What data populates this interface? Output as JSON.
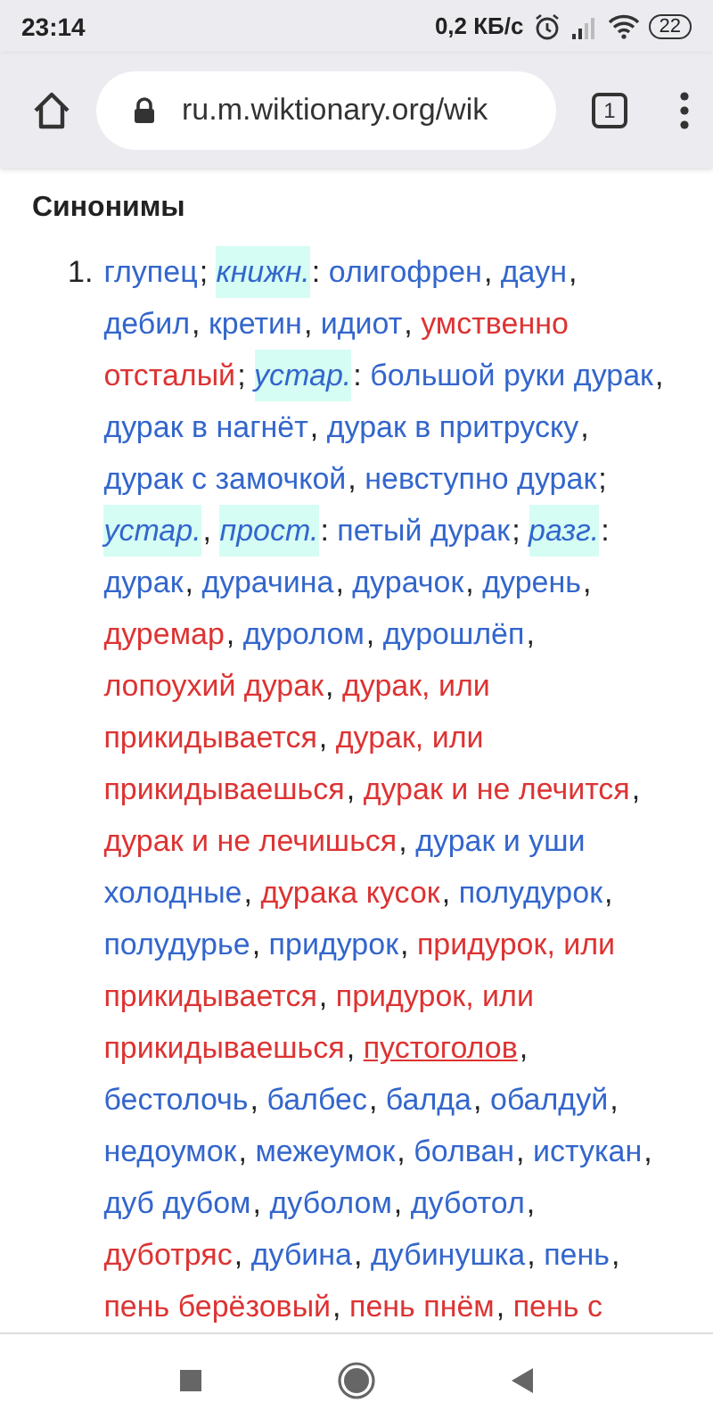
{
  "status_bar": {
    "time": "23:14",
    "speed": "0,2 КБ/с",
    "battery": "22"
  },
  "browser_bar": {
    "url": "ru.m.wiktionary.org/wik",
    "tab_count": "1"
  },
  "section": {
    "heading": "Синонимы",
    "number": "1.",
    "lines": [
      [
        {
          "kind": "link",
          "text": "глупец",
          "punct": "; "
        },
        {
          "kind": "label",
          "text": "книжн.",
          "punct": ": "
        },
        {
          "kind": "link",
          "text": "олигофрен",
          "punct": ", "
        },
        {
          "kind": "link",
          "text": "даун",
          "punct": ","
        }
      ],
      [
        {
          "kind": "link",
          "text": "дебил",
          "punct": ", "
        },
        {
          "kind": "link",
          "text": "кретин",
          "punct": ", "
        },
        {
          "kind": "link",
          "text": "идиот",
          "punct": ", "
        },
        {
          "kind": "redlink",
          "text": "умственно"
        }
      ],
      [
        {
          "kind": "redlink",
          "text": "отсталый",
          "punct": "; "
        },
        {
          "kind": "label",
          "text": "устар.",
          "punct": ": "
        },
        {
          "kind": "link",
          "text": "большой руки дурак",
          "punct": ","
        }
      ],
      [
        {
          "kind": "link",
          "text": "дурак в нагнёт",
          "punct": ", "
        },
        {
          "kind": "link",
          "text": "дурак в притруску",
          "punct": ","
        }
      ],
      [
        {
          "kind": "link",
          "text": "дурак с замочкой",
          "punct": ", "
        },
        {
          "kind": "link",
          "text": "невступно дурак",
          "punct": ";"
        }
      ],
      [
        {
          "kind": "label",
          "text": "устар.",
          "punct": ", "
        },
        {
          "kind": "label",
          "text": "прост.",
          "punct": ": "
        },
        {
          "kind": "link",
          "text": "петый дурак",
          "punct": "; "
        },
        {
          "kind": "label",
          "text": "разг.",
          "punct": ":"
        }
      ],
      [
        {
          "kind": "link",
          "text": "дурак",
          "punct": ", "
        },
        {
          "kind": "link",
          "text": "дурачина",
          "punct": ", "
        },
        {
          "kind": "link",
          "text": "дурачок",
          "punct": ", "
        },
        {
          "kind": "link",
          "text": "дурень",
          "punct": ","
        }
      ],
      [
        {
          "kind": "redlink",
          "text": "дуремар",
          "punct": ", "
        },
        {
          "kind": "link",
          "text": "дуролом",
          "punct": ", "
        },
        {
          "kind": "link",
          "text": "дурошлёп",
          "punct": ","
        }
      ],
      [
        {
          "kind": "redlink",
          "text": "лопоухий дурак",
          "punct": ", "
        },
        {
          "kind": "redlink",
          "text": "дурак, или"
        }
      ],
      [
        {
          "kind": "redlink",
          "text": "прикидывается",
          "punct": ", "
        },
        {
          "kind": "redlink",
          "text": "дурак, или"
        }
      ],
      [
        {
          "kind": "redlink",
          "text": "прикидываешься",
          "punct": ", "
        },
        {
          "kind": "redlink",
          "text": "дурак и не лечится",
          "punct": ","
        }
      ],
      [
        {
          "kind": "redlink",
          "text": "дурак и не лечишься",
          "punct": ", "
        },
        {
          "kind": "link",
          "text": "дурак и уши"
        }
      ],
      [
        {
          "kind": "link",
          "text": "холодные",
          "punct": ", "
        },
        {
          "kind": "redlink",
          "text": "дурака кусок",
          "punct": ", "
        },
        {
          "kind": "link",
          "text": "полудурок",
          "punct": ","
        }
      ],
      [
        {
          "kind": "link",
          "text": "полудурье",
          "punct": ", "
        },
        {
          "kind": "link",
          "text": "придурок",
          "punct": ", "
        },
        {
          "kind": "redlink",
          "text": "придурок, или"
        }
      ],
      [
        {
          "kind": "redlink",
          "text": "прикидывается",
          "punct": ", "
        },
        {
          "kind": "redlink",
          "text": "придурок, или"
        }
      ],
      [
        {
          "kind": "redlink",
          "text": "прикидываешься",
          "punct": ", "
        },
        {
          "kind": "redlink",
          "text": "пустоголов",
          "underline": true,
          "punct": ","
        }
      ],
      [
        {
          "kind": "link",
          "text": "бестолочь",
          "punct": ", "
        },
        {
          "kind": "link",
          "text": "балбес",
          "punct": ", "
        },
        {
          "kind": "link",
          "text": "балда",
          "punct": ", "
        },
        {
          "kind": "link",
          "text": "обалдуй",
          "punct": ","
        }
      ],
      [
        {
          "kind": "link",
          "text": "недоумок",
          "punct": ", "
        },
        {
          "kind": "link",
          "text": "межеумок",
          "punct": ", "
        },
        {
          "kind": "link",
          "text": "болван",
          "punct": ", "
        },
        {
          "kind": "link",
          "text": "истукан",
          "punct": ","
        }
      ],
      [
        {
          "kind": "link",
          "text": "дуб дубом",
          "punct": ", "
        },
        {
          "kind": "link",
          "text": "дуболом",
          "punct": ", "
        },
        {
          "kind": "link",
          "text": "дуботол",
          "punct": ","
        }
      ],
      [
        {
          "kind": "redlink",
          "text": "дуботряс",
          "punct": ", "
        },
        {
          "kind": "link",
          "text": "дубина",
          "punct": ", "
        },
        {
          "kind": "link",
          "text": "дубинушка",
          "punct": ", "
        },
        {
          "kind": "link",
          "text": "пень",
          "punct": ","
        }
      ],
      [
        {
          "kind": "redlink",
          "text": "пень берёзовый",
          "punct": ", "
        },
        {
          "kind": "redlink",
          "text": "пень пнём",
          "punct": ", "
        },
        {
          "kind": "redlink",
          "text": "пень с"
        }
      ]
    ]
  }
}
